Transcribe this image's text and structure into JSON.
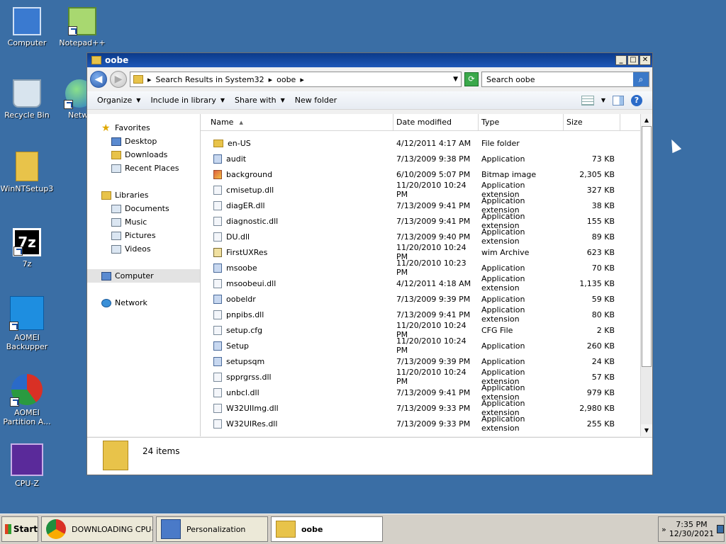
{
  "desktop": {
    "icons": [
      {
        "label": "Computer"
      },
      {
        "label": "Notepad++"
      },
      {
        "label": "Recycle Bin"
      },
      {
        "label": "Netw"
      },
      {
        "label": "WinNTSetup3"
      },
      {
        "label": "7z"
      },
      {
        "label": "AOMEI Backupper"
      },
      {
        "label": "AOMEI Partition A..."
      },
      {
        "label": "CPU-Z"
      }
    ]
  },
  "window": {
    "title": "oobe",
    "controls": {
      "minimize": "_",
      "maximize": "□",
      "close": "✕"
    },
    "address": {
      "path": [
        "Search Results in System32",
        "oobe"
      ],
      "search_placeholder": "Search oobe"
    },
    "commands": {
      "organize": "Organize",
      "include": "Include in library",
      "share": "Share with",
      "new_folder": "New folder"
    },
    "nav": {
      "favorites": "Favorites",
      "desktop": "Desktop",
      "downloads": "Downloads",
      "recent": "Recent Places",
      "libraries": "Libraries",
      "documents": "Documents",
      "music": "Music",
      "pictures": "Pictures",
      "videos": "Videos",
      "computer": "Computer",
      "network": "Network"
    },
    "columns": {
      "name": "Name",
      "date": "Date modified",
      "type": "Type",
      "size": "Size"
    },
    "files": [
      {
        "name": "en-US",
        "date": "4/12/2011 4:17 AM",
        "type": "File folder",
        "size": ""
      },
      {
        "name": "audit",
        "date": "7/13/2009 9:38 PM",
        "type": "Application",
        "size": "73 KB"
      },
      {
        "name": "background",
        "date": "6/10/2009 5:07 PM",
        "type": "Bitmap image",
        "size": "2,305 KB"
      },
      {
        "name": "cmisetup.dll",
        "date": "11/20/2010 10:24 PM",
        "type": "Application extension",
        "size": "327 KB"
      },
      {
        "name": "diagER.dll",
        "date": "7/13/2009 9:41 PM",
        "type": "Application extension",
        "size": "38 KB"
      },
      {
        "name": "diagnostic.dll",
        "date": "7/13/2009 9:41 PM",
        "type": "Application extension",
        "size": "155 KB"
      },
      {
        "name": "DU.dll",
        "date": "7/13/2009 9:40 PM",
        "type": "Application extension",
        "size": "89 KB"
      },
      {
        "name": "FirstUXRes",
        "date": "11/20/2010 10:24 PM",
        "type": "wim Archive",
        "size": "623 KB"
      },
      {
        "name": "msoobe",
        "date": "11/20/2010 10:23 PM",
        "type": "Application",
        "size": "70 KB"
      },
      {
        "name": "msoobeui.dll",
        "date": "4/12/2011 4:18 AM",
        "type": "Application extension",
        "size": "1,135 KB"
      },
      {
        "name": "oobeldr",
        "date": "7/13/2009 9:39 PM",
        "type": "Application",
        "size": "59 KB"
      },
      {
        "name": "pnpibs.dll",
        "date": "7/13/2009 9:41 PM",
        "type": "Application extension",
        "size": "80 KB"
      },
      {
        "name": "setup.cfg",
        "date": "11/20/2010 10:24 PM",
        "type": "CFG File",
        "size": "2 KB"
      },
      {
        "name": "Setup",
        "date": "11/20/2010 10:24 PM",
        "type": "Application",
        "size": "260 KB"
      },
      {
        "name": "setupsqm",
        "date": "7/13/2009 9:39 PM",
        "type": "Application",
        "size": "24 KB"
      },
      {
        "name": "spprgrss.dll",
        "date": "11/20/2010 10:24 PM",
        "type": "Application extension",
        "size": "57 KB"
      },
      {
        "name": "unbcl.dll",
        "date": "7/13/2009 9:41 PM",
        "type": "Application extension",
        "size": "979 KB"
      },
      {
        "name": "W32UIImg.dll",
        "date": "7/13/2009 9:33 PM",
        "type": "Application extension",
        "size": "2,980 KB"
      },
      {
        "name": "W32UIRes.dll",
        "date": "7/13/2009 9:33 PM",
        "type": "Application extension",
        "size": "255 KB"
      }
    ],
    "status": "24 items"
  },
  "taskbar": {
    "start": "Start",
    "tasks": [
      {
        "label": "DOWNLOADING CPU-..."
      },
      {
        "label": "Personalization"
      },
      {
        "label": "oobe"
      }
    ],
    "time": "7:35 PM",
    "date": "12/30/2021",
    "tray_chevron": "»"
  }
}
